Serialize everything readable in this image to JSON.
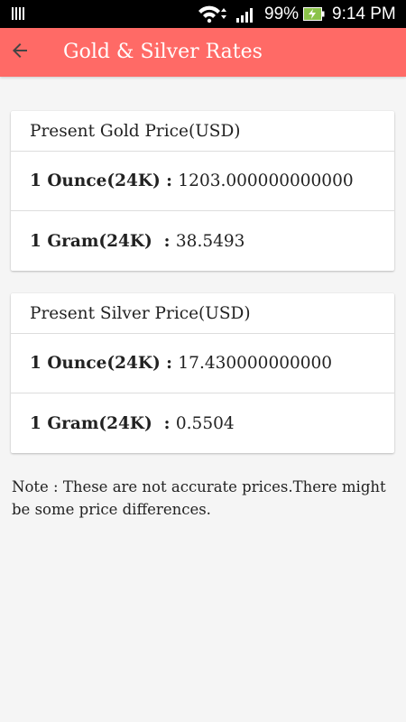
{
  "status_bar": {
    "battery_percent": "99%",
    "time": "9:14 PM",
    "icons": [
      "notification-icon",
      "wifi-icon",
      "signal-icon",
      "battery-charging-icon"
    ]
  },
  "app_bar": {
    "title": "Gold & Silver Rates",
    "back_icon": "arrow-left-icon",
    "color": "#ff6a66"
  },
  "gold_card": {
    "header": "Present Gold Price(USD)",
    "rows": [
      {
        "label": "1 Ounce(24K) : ",
        "value": "1203.000000000000"
      },
      {
        "label": "1 Gram(24K)  : ",
        "value": "38.5493"
      }
    ]
  },
  "silver_card": {
    "header": "Present Silver Price(USD)",
    "rows": [
      {
        "label": "1 Ounce(24K) : ",
        "value": "17.430000000000"
      },
      {
        "label": "1 Gram(24K)  : ",
        "value": "0.5504"
      }
    ]
  },
  "note": "Note : These are not accurate prices.There might be some price differences."
}
